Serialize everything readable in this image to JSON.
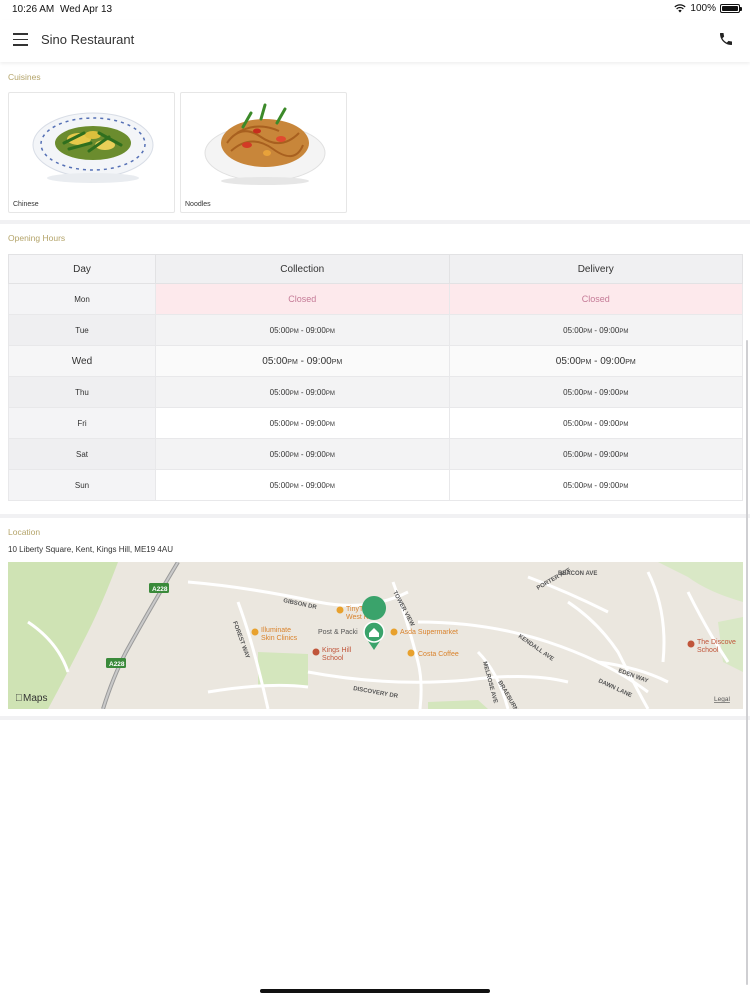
{
  "status_bar": {
    "time": "10:26 AM",
    "date": "Wed Apr 13",
    "battery": "100%"
  },
  "nav": {
    "title": "Sino Restaurant",
    "menu_icon": "hamburger-menu-icon",
    "phone_icon": "phone-icon"
  },
  "cuisines": {
    "label": "Cuisines",
    "items": [
      {
        "label": "Chinese"
      },
      {
        "label": "Noodles"
      }
    ]
  },
  "opening_hours": {
    "label": "Opening Hours",
    "headers": {
      "day": "Day",
      "collection": "Collection",
      "delivery": "Delivery"
    },
    "rows": [
      {
        "day": "Mon",
        "closed": "Closed"
      },
      {
        "day": "Tue",
        "open": "05:00",
        "open_pm": "PM",
        "dash": " - ",
        "close": "09:00",
        "close_pm": "PM"
      },
      {
        "day": "Wed",
        "open": "05:00",
        "open_pm": "PM",
        "dash": " - ",
        "close": "09:00",
        "close_pm": "PM"
      },
      {
        "day": "Thu",
        "open": "05:00",
        "open_pm": "PM",
        "dash": " - ",
        "close": "09:00",
        "close_pm": "PM"
      },
      {
        "day": "Fri",
        "open": "05:00",
        "open_pm": "PM",
        "dash": " - ",
        "close": "09:00",
        "close_pm": "PM"
      },
      {
        "day": "Sat",
        "open": "05:00",
        "open_pm": "PM",
        "dash": " - ",
        "close": "09:00",
        "close_pm": "PM"
      },
      {
        "day": "Sun",
        "open": "05:00",
        "open_pm": "PM",
        "dash": " - ",
        "close": "09:00",
        "close_pm": "PM"
      }
    ]
  },
  "location": {
    "label": "Location",
    "address": "10 Liberty Square, Kent, Kings Hill, ME19 4AU",
    "map": {
      "roads": [
        "GIBSON DR",
        "TOWER VIEW",
        "FOREST WAY",
        "DISCOVERY DR",
        "KENDALL AVE",
        "PORTER AVE",
        "BEACON AVE",
        "EDEN WAY",
        "DAWN LANE",
        "MELROSE AVE",
        "BRAEBURN"
      ],
      "road_badges": [
        "A228",
        "A228"
      ],
      "pois": [
        "TinyTalk West Kent",
        "Illuminate Skin Clinics",
        "Post & Packi",
        "Asda Supermarket",
        "Kings Hill School",
        "Costa Coffee",
        "The Discove School"
      ],
      "brand": "Maps",
      "legal": "Legal"
    }
  },
  "colors": {
    "section_label": "#b4a46a",
    "closed_text": "#c57b97",
    "closed_bg": "#fde9ec",
    "poi": "#e08a2e",
    "map_pin": "#3aa36b"
  }
}
